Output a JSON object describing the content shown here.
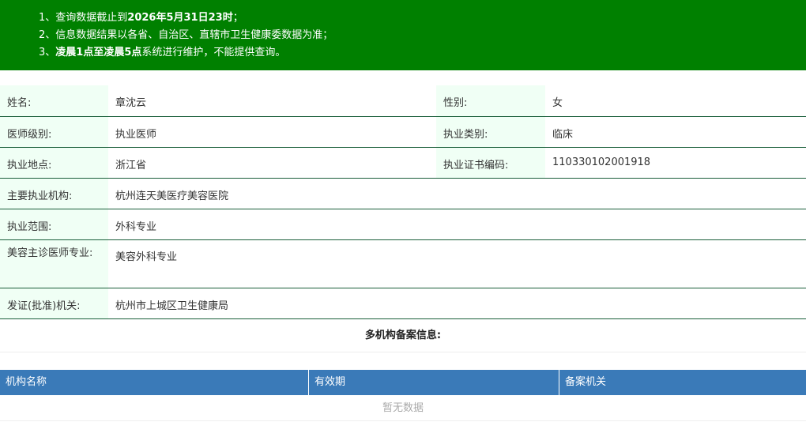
{
  "notice": {
    "line1_prefix": "1、查询数据截止到",
    "line1_bold": "2026年5月31日23时",
    "line1_suffix": "；",
    "line2": "2、信息数据结果以各省、自治区、直辖市卫生健康委数据为准；",
    "line3_prefix": "3、",
    "line3_bold": "凌晨1点至凌晨5点",
    "line3_suffix": "系统进行维护，不能提供查询。"
  },
  "info": {
    "name_label": "姓名:",
    "name_value": "章沈云",
    "gender_label": "性别:",
    "gender_value": "女",
    "level_label": "医师级别:",
    "level_value": "执业医师",
    "category_label": "执业类别:",
    "category_value": "临床",
    "location_label": "执业地点:",
    "location_value": "浙江省",
    "cert_label": "执业证书编码:",
    "cert_value": "110330102001918",
    "institution_label": "主要执业机构:",
    "institution_value": "杭州连天美医疗美容医院",
    "scope_label": "执业范围:",
    "scope_value": "外科专业",
    "cosmetic_label": "美容主诊医师专业:",
    "cosmetic_value": "美容外科专业",
    "authority_label": "发证(批准)机关:",
    "authority_value": "杭州市上城区卫生健康局"
  },
  "multi": {
    "title": "多机构备案信息:",
    "columns": [
      "机构名称",
      "有效期",
      "备案机关"
    ],
    "empty_text": "暂无数据"
  },
  "colors": {
    "notice_bg": "#008000",
    "label_bg": "#f0fff5",
    "grid_header_bg": "#3a7ab8"
  }
}
